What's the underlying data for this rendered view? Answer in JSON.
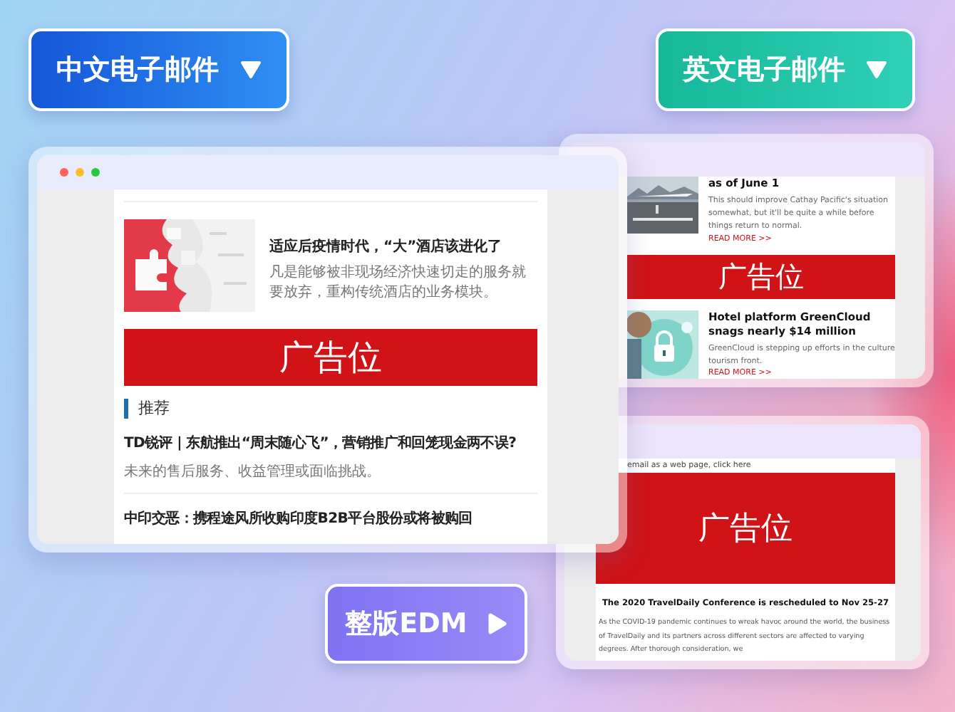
{
  "chinese_email_button": {
    "label": "中文电子邮件"
  },
  "english_email_button": {
    "label": "英文电子邮件"
  },
  "full_edm_button": {
    "label": "整版EDM"
  },
  "chinese_email_window": {
    "feature": {
      "headline": "适应后疫情时代，“大”酒店该进化了",
      "summary": "凡是能够被非现场经济快速切走的服务就要放弃，重构传统酒店的业务模块。"
    },
    "ad_label": "广告位",
    "section_title": "推荐",
    "articles": [
      {
        "headline": "TD锐评 | 东航推出“周末随心飞”，营销推广和回笼现金两不误?",
        "summary": "未来的售后服务、收益管理或面临挑战。"
      },
      {
        "headline": "中印交恶：携程途风所收购印度B2B平台股份或将被购回"
      }
    ]
  },
  "english_email_window_top": {
    "articles": [
      {
        "headline": "as of June 1",
        "summary": "This should improve Cathay Pacific's situation somewhat, but it'll be quite a while before things return to normal.",
        "link": "READ MORE >>"
      }
    ],
    "ad_label": "广告位",
    "articles_after_ad": [
      {
        "headline": "Hotel platform GreenCloud snags nearly $14 million",
        "summary": "GreenCloud is stepping up efforts in the culture tourism front.",
        "link": "READ MORE >>"
      }
    ]
  },
  "english_email_window_bottom": {
    "web_view_link": "email as a web page, click here",
    "ad_label": "广告位",
    "headline": "The 2020 TravelDaily Conference is rescheduled to Nov 25-27",
    "paragraph": "As the COVID-19 pandemic continues to wreak havoc around the world, the business of TravelDaily and its partners across different sectors are affected to varying degrees. After thorough consideration, we"
  }
}
